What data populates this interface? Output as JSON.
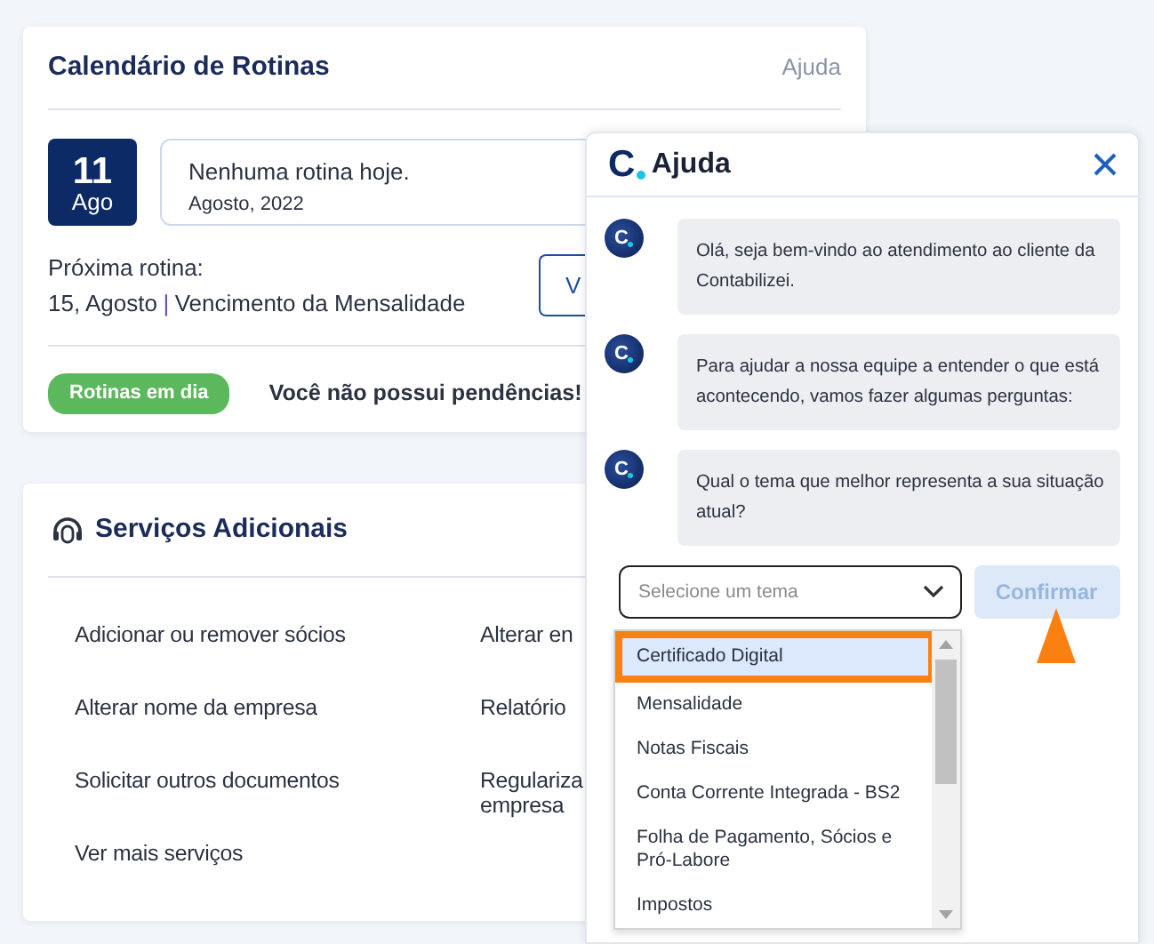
{
  "routine_calendar": {
    "title": "Calendário de Rotinas",
    "help_link": "Ajuda",
    "day": "11",
    "month": "Ago",
    "today_message": "Nenhuma rotina hoje.",
    "today_period": "Agosto, 2022",
    "next_label": "Próxima rotina:",
    "next_date": "15, Agosto",
    "separator": "|",
    "next_name": "Vencimento da Mensalidade",
    "view_button": "V",
    "status_badge": "Rotinas em dia",
    "status_message": "Você não possui pendências!"
  },
  "additional_services": {
    "title": "Serviços Adicionais",
    "services": [
      {
        "lines": [
          "Adicionar ou remover sócios"
        ]
      },
      {
        "lines": [
          "Alterar en"
        ]
      },
      {
        "lines": [
          "Alterar nome da empresa"
        ]
      },
      {
        "lines": [
          "Relatório"
        ]
      },
      {
        "lines": [
          "Solicitar outros documentos"
        ]
      },
      {
        "lines": [
          "Regulariza",
          "empresa"
        ]
      },
      {
        "lines": [
          "Ver mais serviços"
        ]
      }
    ]
  },
  "help_panel": {
    "logo_letter": "C",
    "title": "Ajuda",
    "messages": [
      {
        "avatar_letter": "C",
        "text": "Olá, seja bem-vindo ao atendimento ao cliente da Contabilizei."
      },
      {
        "avatar_letter": "C",
        "text": "Para ajudar a nossa equipe a entender o que está acontecendo, vamos fazer algumas perguntas:"
      },
      {
        "avatar_letter": "C",
        "text": "Qual o tema que melhor representa a sua situação atual?"
      }
    ],
    "select": {
      "placeholder": "Selecione um tema"
    },
    "confirm_button": {
      "label": "Confirmar",
      "disabled": true
    },
    "options": [
      {
        "label": "Certificado Digital",
        "selected": true
      },
      {
        "label": "Mensalidade",
        "selected": false
      },
      {
        "label": "Notas Fiscais",
        "selected": false
      },
      {
        "label": "Conta Corrente Integrada - BS2",
        "selected": false
      },
      {
        "label": "Folha de Pagamento, Sócios e Pró-Labore",
        "selected": false
      },
      {
        "label": "Impostos",
        "selected": false
      }
    ]
  }
}
